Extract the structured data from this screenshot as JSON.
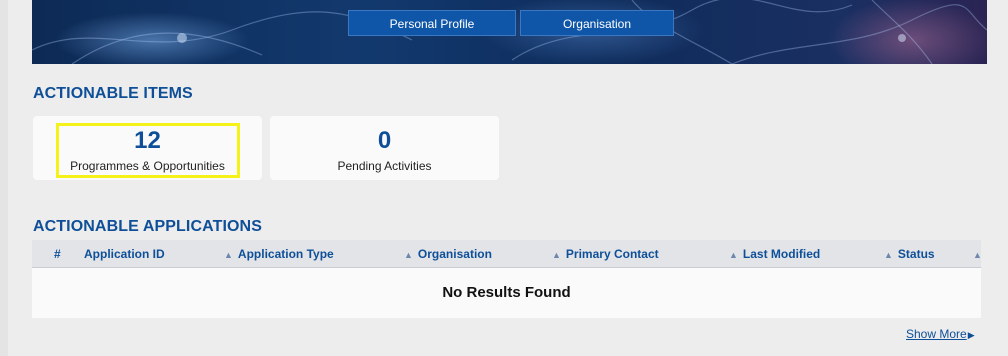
{
  "nav": {
    "personal_profile": "Personal Profile",
    "organisation": "Organisation"
  },
  "actionable_items": {
    "title": "ACTIONABLE ITEMS",
    "cards": [
      {
        "count": "12",
        "label": "Programmes & Opportunities",
        "highlighted": true
      },
      {
        "count": "0",
        "label": "Pending Activities",
        "highlighted": false
      }
    ]
  },
  "actionable_applications": {
    "title": "ACTIONABLE APPLICATIONS",
    "columns": [
      "#",
      "Application ID",
      "Application Type",
      "Organisation",
      "Primary Contact",
      "Last Modified",
      "Status"
    ],
    "empty_message": "No Results Found",
    "show_more": "Show More"
  },
  "colors": {
    "accent": "#0e4f98",
    "nav_button": "#0f56a8",
    "highlight": "#f5f21a",
    "background": "#ededed"
  }
}
